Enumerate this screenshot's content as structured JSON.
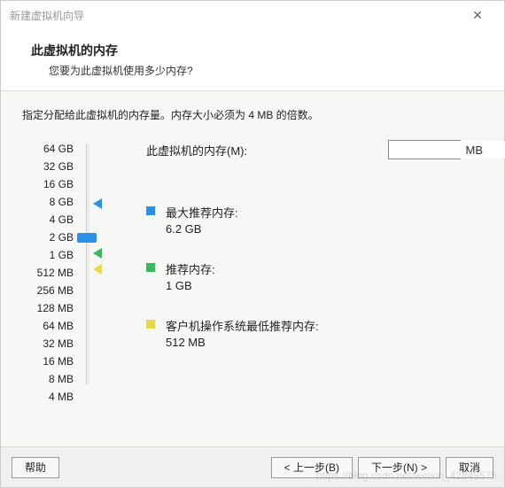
{
  "titlebar": {
    "title": "新建虚拟机向导"
  },
  "header": {
    "title": "此虚拟机的内存",
    "subtitle": "您要为此虚拟机使用多少内存?"
  },
  "instruction": "指定分配给此虚拟机的内存量。内存大小必须为 4 MB 的倍数。",
  "memory": {
    "label": "此虚拟机的内存(M):",
    "value": "2048",
    "unit": "MB"
  },
  "slider": {
    "labels": [
      "64 GB",
      "32 GB",
      "16 GB",
      "8 GB",
      "4 GB",
      "2 GB",
      "1 GB",
      "512 MB",
      "256 MB",
      "128 MB",
      "64 MB",
      "32 MB",
      "16 MB",
      "8 MB",
      "4 MB"
    ]
  },
  "recommendations": {
    "max": {
      "label": "最大推荐内存:",
      "value": "6.2 GB"
    },
    "rec": {
      "label": "推荐内存:",
      "value": "1 GB"
    },
    "min": {
      "label": "客户机操作系统最低推荐内存:",
      "value": "512 MB"
    }
  },
  "footer": {
    "help": "帮助",
    "back": "< 上一步(B)",
    "next": "下一步(N) >",
    "cancel": "取消"
  },
  "watermark": "https://blog.csdn.net/weixin_42849575"
}
